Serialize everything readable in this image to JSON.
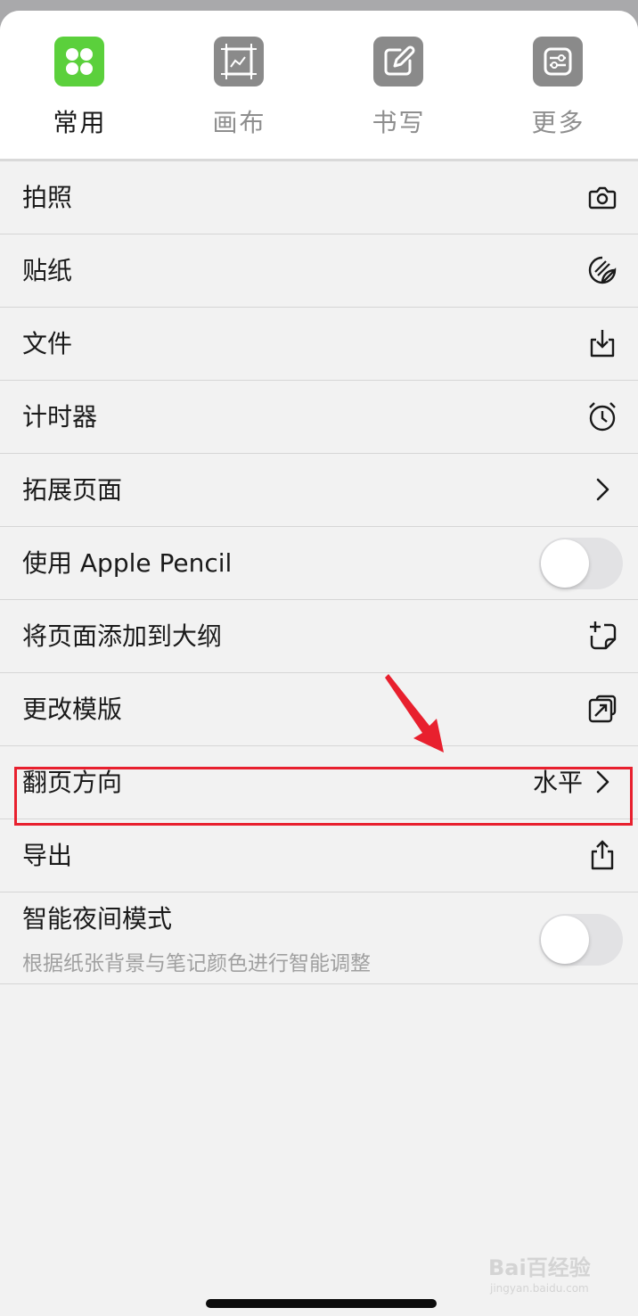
{
  "tabs": [
    {
      "label": "常用",
      "icon": "grid-icon",
      "active": true
    },
    {
      "label": "画布",
      "icon": "canvas-icon",
      "active": false
    },
    {
      "label": "书写",
      "icon": "pencil-edit-icon",
      "active": false
    },
    {
      "label": "更多",
      "icon": "sliders-icon",
      "active": false
    }
  ],
  "rows": {
    "photo": {
      "label": "拍照",
      "icon": "camera-icon"
    },
    "sticker": {
      "label": "贴纸",
      "icon": "sticker-icon"
    },
    "file": {
      "label": "文件",
      "icon": "download-tray-icon"
    },
    "timer": {
      "label": "计时器",
      "icon": "alarm-clock-icon"
    },
    "extend_page": {
      "label": "拓展页面",
      "icon": "chevron-right-icon"
    },
    "apple_pencil": {
      "label": "使用 Apple Pencil",
      "toggle": false
    },
    "add_outline": {
      "label": "将页面添加到大纲",
      "icon": "add-page-icon"
    },
    "change_template": {
      "label": "更改模版",
      "icon": "swap-template-icon"
    },
    "page_direction": {
      "label": "翻页方向",
      "value": "水平",
      "icon": "chevron-right-icon"
    },
    "export": {
      "label": "导出",
      "icon": "share-icon"
    },
    "night_mode": {
      "label": "智能夜间模式",
      "sublabel": "根据纸张背景与笔记颜色进行智能调整",
      "toggle": false
    }
  },
  "annotation": {
    "highlight_color": "#e8202e"
  },
  "colors": {
    "accent": "#5bd03c",
    "inactive_icon": "#8a8a8a"
  },
  "watermark": {
    "main": "Bai百经验",
    "sub": "jingyan.baidu.com"
  }
}
